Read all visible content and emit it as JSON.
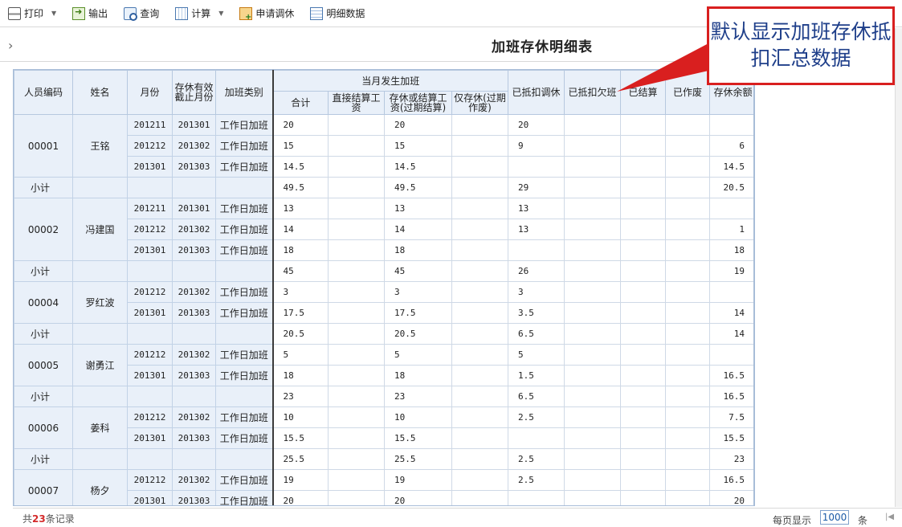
{
  "toolbar": {
    "print": "打印",
    "export": "输出",
    "query": "查询",
    "calc": "计算",
    "apply": "申请调休",
    "detail": "明细数据"
  },
  "page": {
    "title": "加班存休明细表"
  },
  "table": {
    "headers": {
      "emp_id": "人员编码",
      "name": "姓名",
      "month": "月份",
      "expiry_month": "存休有效截止月份",
      "ot_type": "加班类别",
      "current_ot": "当月发生加班",
      "total": "合计",
      "direct_pay": "直接结算工资",
      "store_or_pay": "存休或结算工资(过期结算)",
      "store_only": "仅存休(过期作废)",
      "deducted_leave": "已抵扣调休",
      "deducted_absence": "已抵扣欠班",
      "settled": "已结算",
      "voided": "已作废",
      "balance": "存休余额"
    },
    "rows": [
      {
        "id": "00001",
        "name": "王铭",
        "month": "201211",
        "expiry": "201301",
        "type": "工作日加班",
        "total": "20",
        "direct": "",
        "store_pay": "20",
        "store_only": "",
        "ded_leave": "20",
        "ded_absence": "",
        "settled": "",
        "voided": "",
        "balance": ""
      },
      {
        "id": "",
        "name": "",
        "month": "201212",
        "expiry": "201302",
        "type": "工作日加班",
        "total": "15",
        "direct": "",
        "store_pay": "15",
        "store_only": "",
        "ded_leave": "9",
        "ded_absence": "",
        "settled": "",
        "voided": "",
        "balance": "6"
      },
      {
        "id": "",
        "name": "",
        "month": "201301",
        "expiry": "201303",
        "type": "工作日加班",
        "total": "14.5",
        "direct": "",
        "store_pay": "14.5",
        "store_only": "",
        "ded_leave": "",
        "ded_absence": "",
        "settled": "",
        "voided": "",
        "balance": "14.5"
      },
      {
        "id": "小计",
        "name": "",
        "month": "",
        "expiry": "",
        "type": "",
        "total": "49.5",
        "direct": "",
        "store_pay": "49.5",
        "store_only": "",
        "ded_leave": "29",
        "ded_absence": "",
        "settled": "",
        "voided": "",
        "balance": "20.5",
        "subtotal": true
      },
      {
        "id": "00002",
        "name": "冯建国",
        "month": "201211",
        "expiry": "201301",
        "type": "工作日加班",
        "total": "13",
        "direct": "",
        "store_pay": "13",
        "store_only": "",
        "ded_leave": "13",
        "ded_absence": "",
        "settled": "",
        "voided": "",
        "balance": ""
      },
      {
        "id": "",
        "name": "",
        "month": "201212",
        "expiry": "201302",
        "type": "工作日加班",
        "total": "14",
        "direct": "",
        "store_pay": "14",
        "store_only": "",
        "ded_leave": "13",
        "ded_absence": "",
        "settled": "",
        "voided": "",
        "balance": "1"
      },
      {
        "id": "",
        "name": "",
        "month": "201301",
        "expiry": "201303",
        "type": "工作日加班",
        "total": "18",
        "direct": "",
        "store_pay": "18",
        "store_only": "",
        "ded_leave": "",
        "ded_absence": "",
        "settled": "",
        "voided": "",
        "balance": "18"
      },
      {
        "id": "小计",
        "name": "",
        "month": "",
        "expiry": "",
        "type": "",
        "total": "45",
        "direct": "",
        "store_pay": "45",
        "store_only": "",
        "ded_leave": "26",
        "ded_absence": "",
        "settled": "",
        "voided": "",
        "balance": "19",
        "subtotal": true
      },
      {
        "id": "00004",
        "name": "罗红波",
        "month": "201212",
        "expiry": "201302",
        "type": "工作日加班",
        "total": "3",
        "direct": "",
        "store_pay": "3",
        "store_only": "",
        "ded_leave": "3",
        "ded_absence": "",
        "settled": "",
        "voided": "",
        "balance": ""
      },
      {
        "id": "",
        "name": "",
        "month": "201301",
        "expiry": "201303",
        "type": "工作日加班",
        "total": "17.5",
        "direct": "",
        "store_pay": "17.5",
        "store_only": "",
        "ded_leave": "3.5",
        "ded_absence": "",
        "settled": "",
        "voided": "",
        "balance": "14"
      },
      {
        "id": "小计",
        "name": "",
        "month": "",
        "expiry": "",
        "type": "",
        "total": "20.5",
        "direct": "",
        "store_pay": "20.5",
        "store_only": "",
        "ded_leave": "6.5",
        "ded_absence": "",
        "settled": "",
        "voided": "",
        "balance": "14",
        "subtotal": true
      },
      {
        "id": "00005",
        "name": "谢勇江",
        "month": "201212",
        "expiry": "201302",
        "type": "工作日加班",
        "total": "5",
        "direct": "",
        "store_pay": "5",
        "store_only": "",
        "ded_leave": "5",
        "ded_absence": "",
        "settled": "",
        "voided": "",
        "balance": ""
      },
      {
        "id": "",
        "name": "",
        "month": "201301",
        "expiry": "201303",
        "type": "工作日加班",
        "total": "18",
        "direct": "",
        "store_pay": "18",
        "store_only": "",
        "ded_leave": "1.5",
        "ded_absence": "",
        "settled": "",
        "voided": "",
        "balance": "16.5"
      },
      {
        "id": "小计",
        "name": "",
        "month": "",
        "expiry": "",
        "type": "",
        "total": "23",
        "direct": "",
        "store_pay": "23",
        "store_only": "",
        "ded_leave": "6.5",
        "ded_absence": "",
        "settled": "",
        "voided": "",
        "balance": "16.5",
        "subtotal": true
      },
      {
        "id": "00006",
        "name": "姜科",
        "month": "201212",
        "expiry": "201302",
        "type": "工作日加班",
        "total": "10",
        "direct": "",
        "store_pay": "10",
        "store_only": "",
        "ded_leave": "2.5",
        "ded_absence": "",
        "settled": "",
        "voided": "",
        "balance": "7.5"
      },
      {
        "id": "",
        "name": "",
        "month": "201301",
        "expiry": "201303",
        "type": "工作日加班",
        "total": "15.5",
        "direct": "",
        "store_pay": "15.5",
        "store_only": "",
        "ded_leave": "",
        "ded_absence": "",
        "settled": "",
        "voided": "",
        "balance": "15.5"
      },
      {
        "id": "小计",
        "name": "",
        "month": "",
        "expiry": "",
        "type": "",
        "total": "25.5",
        "direct": "",
        "store_pay": "25.5",
        "store_only": "",
        "ded_leave": "2.5",
        "ded_absence": "",
        "settled": "",
        "voided": "",
        "balance": "23",
        "subtotal": true
      },
      {
        "id": "00007",
        "name": "杨夕",
        "month": "201212",
        "expiry": "201302",
        "type": "工作日加班",
        "total": "19",
        "direct": "",
        "store_pay": "19",
        "store_only": "",
        "ded_leave": "2.5",
        "ded_absence": "",
        "settled": "",
        "voided": "",
        "balance": "16.5"
      },
      {
        "id": "",
        "name": "",
        "month": "201301",
        "expiry": "201303",
        "type": "工作日加班",
        "total": "20",
        "direct": "",
        "store_pay": "20",
        "store_only": "",
        "ded_leave": "",
        "ded_absence": "",
        "settled": "",
        "voided": "",
        "balance": "20"
      }
    ]
  },
  "footer": {
    "total_prefix": "共",
    "total_count": "23",
    "total_suffix": "条记录",
    "page_size_label": "每页显示",
    "page_size_value": "1000",
    "page_size_unit": "条"
  },
  "callout": {
    "text": "默认显示加班存休抵扣汇总数据"
  },
  "colors": {
    "callout_border": "#d91f1f",
    "callout_text": "#1f3f8a",
    "header_bg": "#e9f0f9",
    "total_count": "#d42a2a"
  }
}
